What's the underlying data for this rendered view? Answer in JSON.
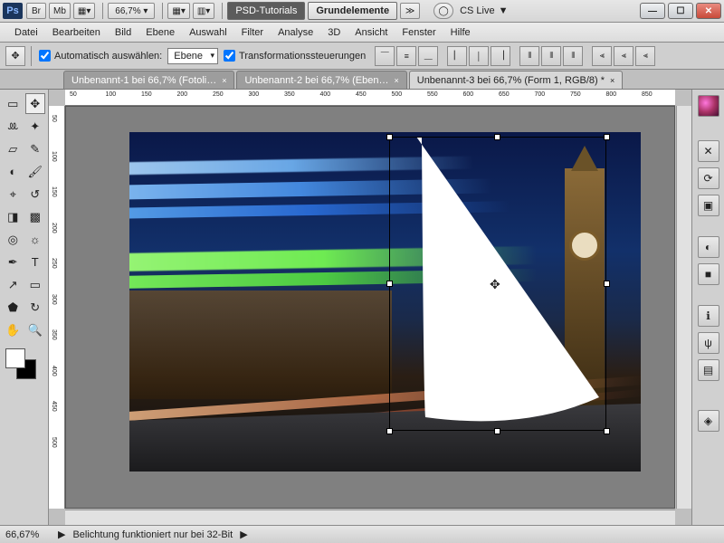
{
  "titlebar": {
    "ps": "Ps",
    "br": "Br",
    "mb": "Mb",
    "zoom": "66,7%",
    "psd_tutorials": "PSD-Tutorials",
    "grundelemente": "Grundelemente",
    "expand": "≫",
    "cslive": "CS Live",
    "drop": "▼"
  },
  "menu": {
    "datei": "Datei",
    "bearbeiten": "Bearbeiten",
    "bild": "Bild",
    "ebene": "Ebene",
    "auswahl": "Auswahl",
    "filter": "Filter",
    "analyse": "Analyse",
    "dreid": "3D",
    "ansicht": "Ansicht",
    "fenster": "Fenster",
    "hilfe": "Hilfe"
  },
  "options": {
    "auto_select": "Automatisch auswählen:",
    "layer": "Ebene",
    "transform": "Transformationssteuerungen"
  },
  "tabs": {
    "t1": "Unbenannt-1 bei 66,7% (Fotoli…",
    "t2": "Unbenannt-2 bei 66,7% (Eben…",
    "t3": "Unbenannt-3 bei 66,7% (Form 1, RGB/8) *",
    "close": "×"
  },
  "ruler": {
    "ticks": [
      "50",
      "100",
      "150",
      "200",
      "250",
      "300",
      "350",
      "400",
      "450",
      "500",
      "550",
      "600",
      "650",
      "700",
      "750",
      "800",
      "850"
    ]
  },
  "rulerv": {
    "ticks": [
      "50",
      "100",
      "150",
      "200",
      "250",
      "300",
      "350",
      "400",
      "450",
      "500"
    ]
  },
  "status": {
    "zoom": "66,67%",
    "msg": "Belichtung funktioniert nur bei 32-Bit"
  },
  "tools": {
    "rect-marquee": "▭",
    "move": "✥",
    "lasso": "ꔛ",
    "wand": "✦",
    "crop": "▱",
    "eyedrop": "✎",
    "heal": "◐",
    "brush": "🖌",
    "stamp": "⌖",
    "history": "↺",
    "eraser": "◨",
    "gradient": "▩",
    "blur": "◎",
    "dodge": "☼",
    "pen": "✒",
    "type": "T",
    "path": "↗",
    "shape": "▭",
    "hand": "✋",
    "zoom": "🔍",
    "threeD": "⬟",
    "rot": "↻"
  },
  "right_icons": {
    "sphere": "◉",
    "tools": "✕",
    "history": "⟳",
    "sq": "▣",
    "half": "◐",
    "cam": "■",
    "info": "ℹ",
    "usb": "ψ",
    "lay": "▤",
    "diamond": "◈"
  }
}
